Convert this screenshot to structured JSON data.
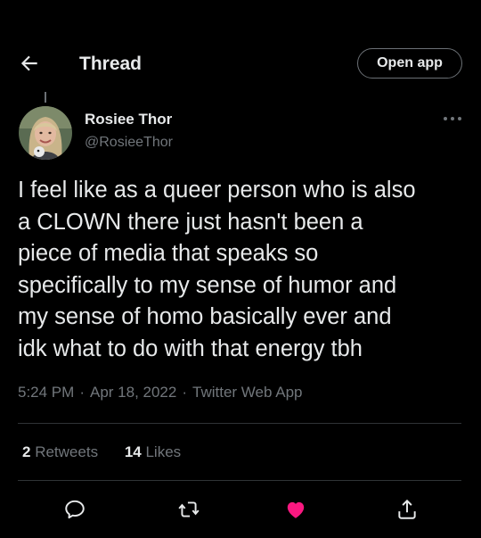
{
  "header": {
    "title": "Thread",
    "open_app_label": "Open app"
  },
  "author": {
    "name": "Rosiee Thor",
    "handle": "@RosieeThor"
  },
  "tweet": {
    "lines": [
      "I feel like as a queer person who is also",
      "a CLOWN there just hasn't been a",
      "piece of media that speaks so",
      "specifically to my sense of humor and",
      "my sense of homo basically ever and",
      "idk what to do with that energy tbh"
    ],
    "time": "5:24 PM",
    "date": "Apr 18, 2022",
    "source": "Twitter Web App",
    "separator": "·"
  },
  "stats": {
    "retweets_count": "2",
    "retweets_label": "Retweets",
    "likes_count": "14",
    "likes_label": "Likes"
  },
  "colors": {
    "background": "#000000",
    "text": "#e7e9ea",
    "secondary": "#71767b",
    "like_active": "#f91880",
    "divider": "#2f3336"
  },
  "icons": {
    "back": "back-arrow-icon",
    "more": "more-icon",
    "reply": "reply-icon",
    "retweet": "retweet-icon",
    "like": "heart-icon",
    "share": "share-icon"
  }
}
